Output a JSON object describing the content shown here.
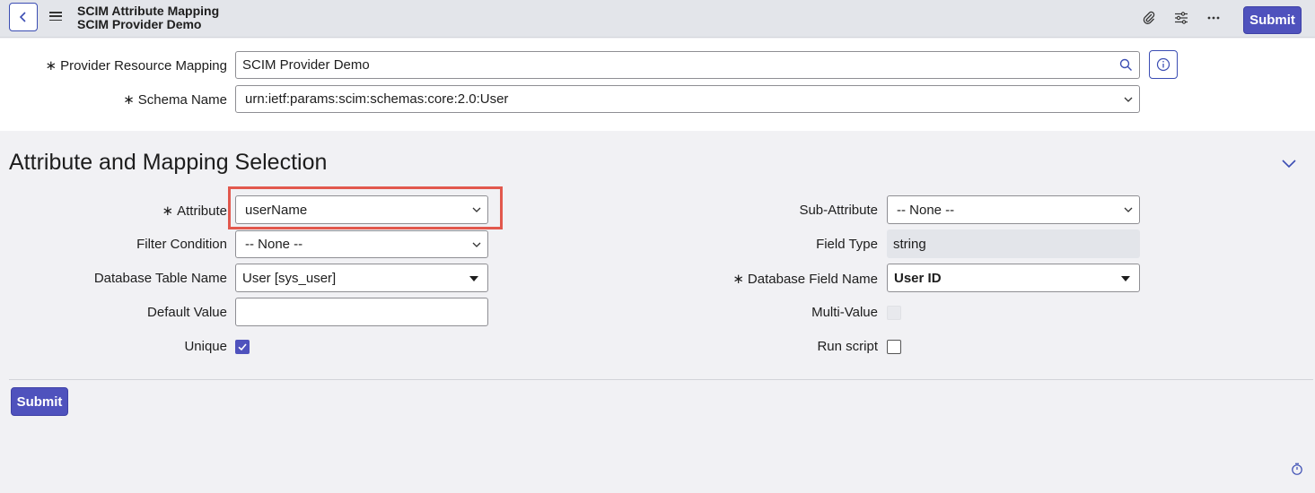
{
  "header": {
    "title": "SCIM Attribute Mapping",
    "subtitle": "SCIM Provider Demo",
    "submit_label": "Submit",
    "icons": [
      "back-icon",
      "menu-icon",
      "paperclip-icon",
      "settings-sliders-icon",
      "more-icon"
    ]
  },
  "top_form": {
    "provider_label": "Provider Resource Mapping",
    "provider_value": "SCIM Provider Demo",
    "schema_label": "Schema Name",
    "schema_value": "urn:ietf:params:scim:schemas:core:2.0:User",
    "required_mark": "∗"
  },
  "section": {
    "title": "Attribute and Mapping Selection",
    "attribute_label": "Attribute",
    "attribute_value": "userName",
    "filter_label": "Filter Condition",
    "filter_value": "-- None --",
    "table_label": "Database Table Name",
    "table_value": "User [sys_user]",
    "default_label": "Default Value",
    "default_value": "",
    "unique_label": "Unique",
    "unique_checked": true,
    "sub_attr_label": "Sub-Attribute",
    "sub_attr_value": "-- None --",
    "field_type_label": "Field Type",
    "field_type_value": "string",
    "db_field_label": "Database Field Name",
    "db_field_value": "User ID",
    "multi_value_label": "Multi-Value",
    "multi_value_checked": false,
    "run_script_label": "Run script",
    "run_script_checked": false
  },
  "footer": {
    "submit_label": "Submit"
  },
  "colors": {
    "accent": "#4f52bd",
    "highlight": "#e2584d",
    "header_bg": "#e3e5ea"
  }
}
